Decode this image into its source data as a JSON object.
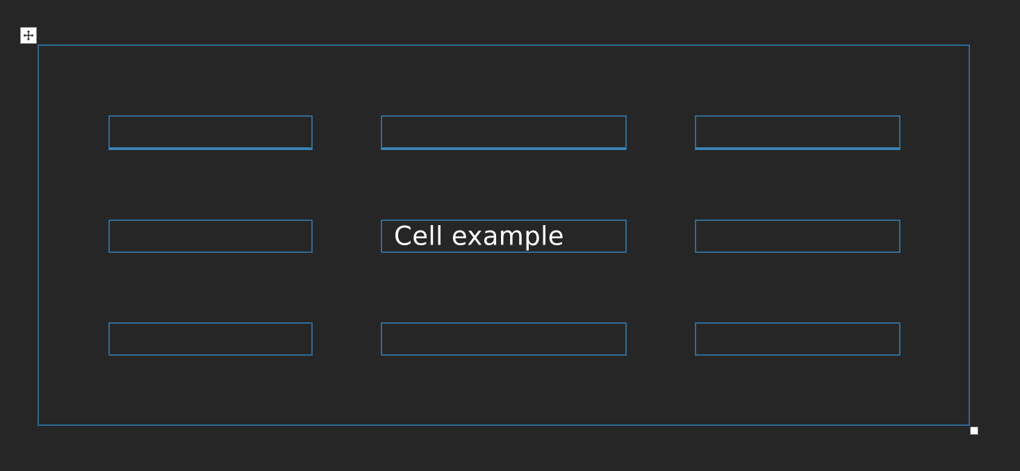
{
  "table": {
    "rows": [
      [
        "",
        "",
        ""
      ],
      [
        "",
        "Cell example",
        ""
      ],
      [
        "",
        "",
        ""
      ]
    ]
  },
  "icons": {
    "move": "move-arrows-icon",
    "resize": "resize-handle"
  },
  "colors": {
    "background": "#262626",
    "border": "#2e6e96",
    "header_underline": "#3a82b4",
    "text": "#ffffff"
  }
}
